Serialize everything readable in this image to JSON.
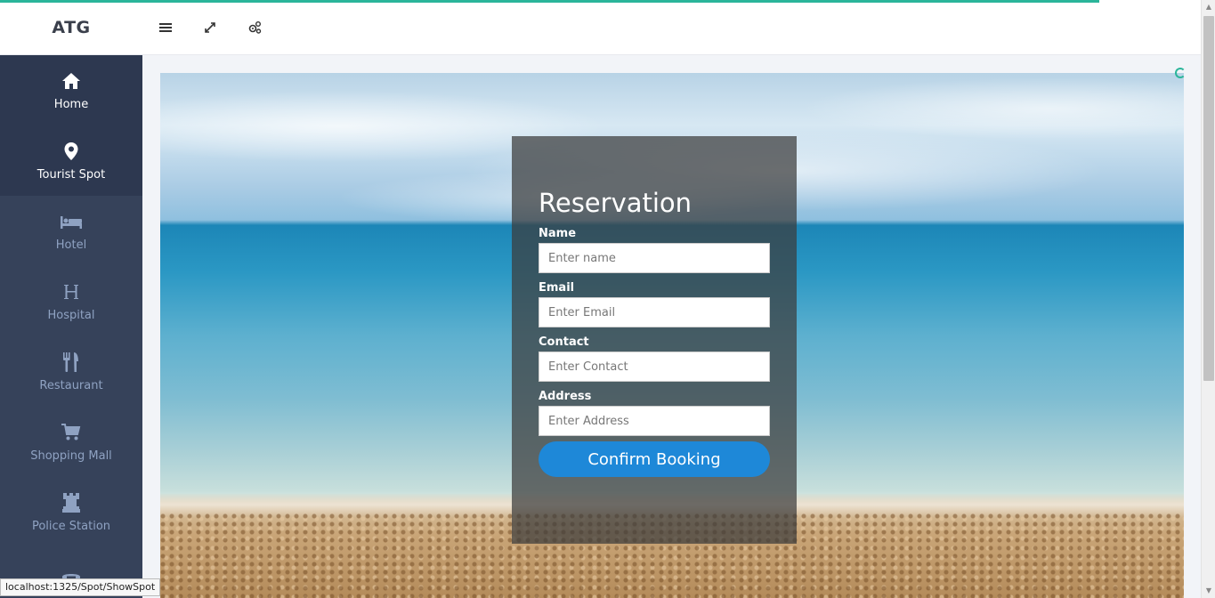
{
  "app": {
    "brand": "ATG"
  },
  "toolbar": {
    "icons": [
      "menu-icon",
      "expand-icon",
      "settings-icon"
    ]
  },
  "sidebar": {
    "items": [
      {
        "label": "Home",
        "icon": "home-icon",
        "active": true
      },
      {
        "label": "Tourist Spot",
        "icon": "map-pin-icon",
        "active": true
      },
      {
        "label": "Hotel",
        "icon": "bed-icon",
        "active": false
      },
      {
        "label": "Hospital",
        "icon": "hospital-icon",
        "active": false
      },
      {
        "label": "Restaurant",
        "icon": "utensils-icon",
        "active": false
      },
      {
        "label": "Shopping Mall",
        "icon": "cart-icon",
        "active": false
      },
      {
        "label": "Police Station",
        "icon": "tower-icon",
        "active": false
      },
      {
        "label": "",
        "icon": "phone-icon",
        "active": false
      }
    ]
  },
  "form": {
    "title": "Reservation",
    "fields": [
      {
        "label": "Name",
        "placeholder": "Enter name",
        "value": ""
      },
      {
        "label": "Email",
        "placeholder": "Enter Email",
        "value": ""
      },
      {
        "label": "Contact",
        "placeholder": "Enter Contact",
        "value": ""
      },
      {
        "label": "Address",
        "placeholder": "Enter Address",
        "value": ""
      }
    ],
    "submit_label": "Confirm Booking"
  },
  "status": {
    "url": "localhost:1325/Spot/ShowSpot"
  },
  "colors": {
    "sidebar_bg": "#36425a",
    "sidebar_active_bg": "#2d3850",
    "accent_teal": "#2bb59a",
    "button_blue": "#1e88d8"
  }
}
